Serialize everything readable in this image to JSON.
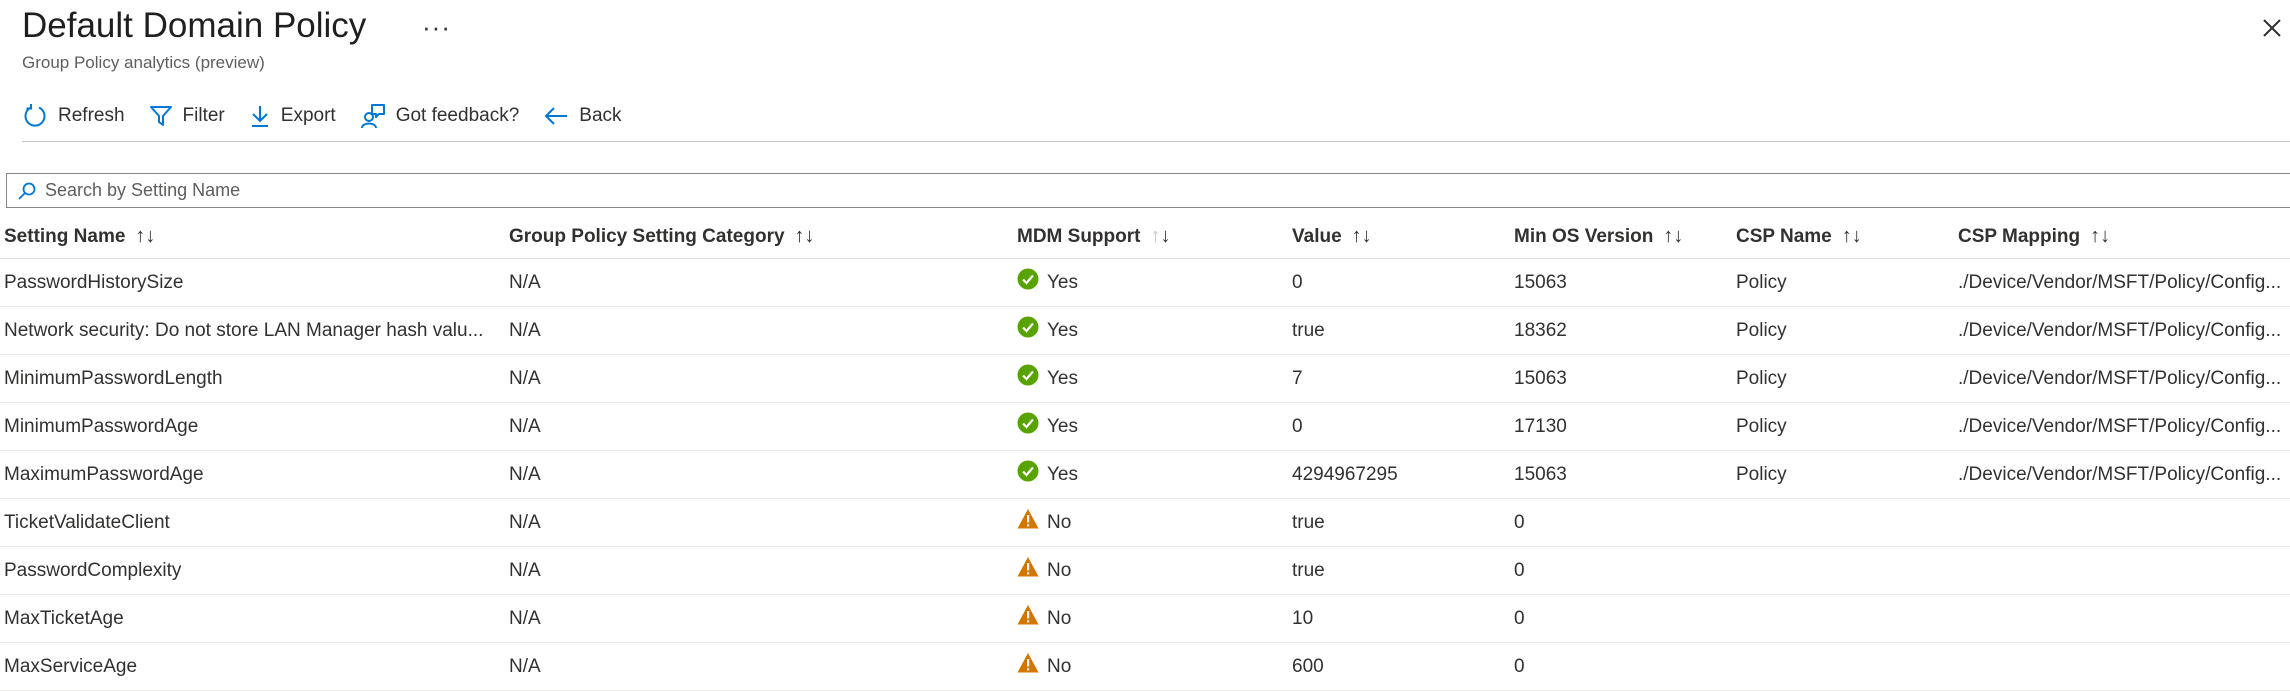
{
  "header": {
    "title": "Default Domain Policy",
    "more": "···",
    "subtitle": "Group Policy analytics (preview)"
  },
  "toolbar": {
    "refresh": "Refresh",
    "filter": "Filter",
    "export": "Export",
    "feedback": "Got feedback?",
    "back": "Back"
  },
  "search": {
    "placeholder": "Search by Setting Name"
  },
  "table": {
    "columns": [
      "Setting Name",
      "Group Policy Setting Category",
      "MDM Support",
      "Value",
      "Min OS Version",
      "CSP Name",
      "CSP Mapping"
    ],
    "sort_icon": "↑↓",
    "rows": [
      {
        "name": "PasswordHistorySize",
        "category": "N/A",
        "mdm": "Yes",
        "value": "0",
        "min_os": "15063",
        "csp_name": "Policy",
        "csp_mapping": "./Device/Vendor/MSFT/Policy/Config..."
      },
      {
        "name": "Network security: Do not store LAN Manager hash valu...",
        "category": "N/A",
        "mdm": "Yes",
        "value": "true",
        "min_os": "18362",
        "csp_name": "Policy",
        "csp_mapping": "./Device/Vendor/MSFT/Policy/Config..."
      },
      {
        "name": "MinimumPasswordLength",
        "category": "N/A",
        "mdm": "Yes",
        "value": "7",
        "min_os": "15063",
        "csp_name": "Policy",
        "csp_mapping": "./Device/Vendor/MSFT/Policy/Config..."
      },
      {
        "name": "MinimumPasswordAge",
        "category": "N/A",
        "mdm": "Yes",
        "value": "0",
        "min_os": "17130",
        "csp_name": "Policy",
        "csp_mapping": "./Device/Vendor/MSFT/Policy/Config..."
      },
      {
        "name": "MaximumPasswordAge",
        "category": "N/A",
        "mdm": "Yes",
        "value": "4294967295",
        "min_os": "15063",
        "csp_name": "Policy",
        "csp_mapping": "./Device/Vendor/MSFT/Policy/Config..."
      },
      {
        "name": "TicketValidateClient",
        "category": "N/A",
        "mdm": "No",
        "value": "true",
        "min_os": "0",
        "csp_name": "",
        "csp_mapping": ""
      },
      {
        "name": "PasswordComplexity",
        "category": "N/A",
        "mdm": "No",
        "value": "true",
        "min_os": "0",
        "csp_name": "",
        "csp_mapping": ""
      },
      {
        "name": "MaxTicketAge",
        "category": "N/A",
        "mdm": "No",
        "value": "10",
        "min_os": "0",
        "csp_name": "",
        "csp_mapping": ""
      },
      {
        "name": "MaxServiceAge",
        "category": "N/A",
        "mdm": "No",
        "value": "600",
        "min_os": "0",
        "csp_name": "",
        "csp_mapping": ""
      }
    ]
  },
  "colors": {
    "yes": "#57a300",
    "no": "#d47500",
    "accent": "#0078d4"
  }
}
